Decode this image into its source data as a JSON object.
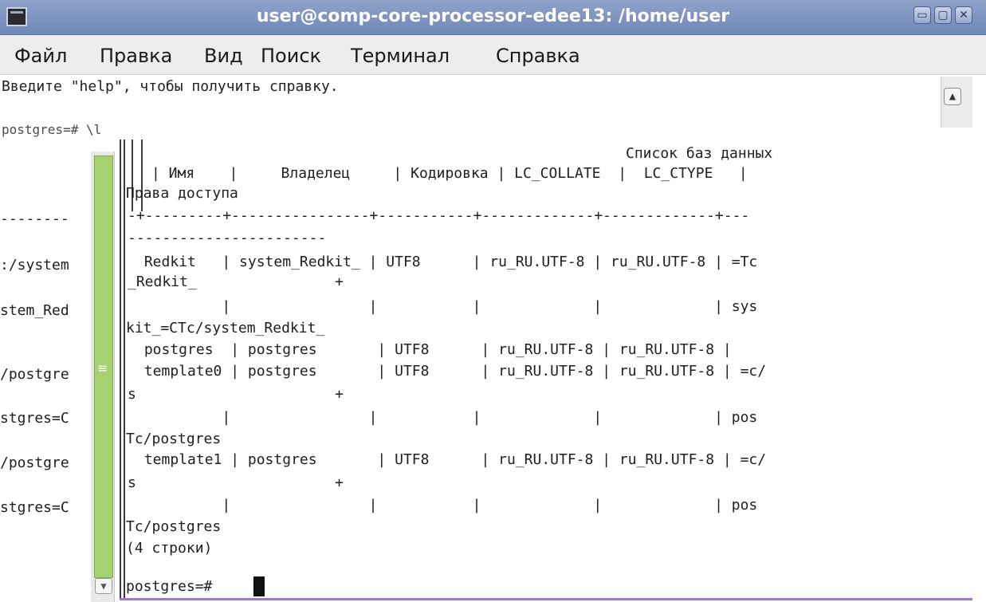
{
  "window": {
    "title": "user@comp-core-processor-edee13: /home/user",
    "app_icon": "terminal-icon",
    "buttons": {
      "minimize": "▭",
      "maximize": "▢",
      "close": "✕"
    }
  },
  "menu": [
    "Файл",
    "Правка",
    "Вид",
    "Поиск",
    "Терминал",
    "Справка"
  ],
  "terminal": {
    "help_line": "Введите \"help\", чтобы получить справку.",
    "cmd_echo": "postgres=# \\l",
    "table_title": "Список баз данных",
    "header": "| Имя    |     Владелец     | Кодировка | LC_COLLATE  |  LC_CTYPE   |",
    "header_wrap": "Права доступа",
    "sep1": "-+---------+----------------+-----------+-------------+-------------+---",
    "sep2": "-----------------------",
    "rows": [
      " Redkit   | system_Redkit_ | UTF8      | ru_RU.UTF-8 | ru_RU.UTF-8 | =Tc",
      "_Redkit_                +",
      "          |                |           |             |             | sys",
      "kit_=CTc/system_Redkit_",
      " postgres  | postgres       | UTF8      | ru_RU.UTF-8 | ru_RU.UTF-8 |",
      " template0 | postgres       | UTF8      | ru_RU.UTF-8 | ru_RU.UTF-8 | =c/",
      "s                       +",
      "          |                |           |             |             | pos",
      "Tc/postgres",
      " template1 | postgres       | UTF8      | ru_RU.UTF-8 | ru_RU.UTF-8 | =c/",
      "s                       +",
      "          |                |           |             |             | pos",
      "Tc/postgres"
    ],
    "row_count": "(4 строки)",
    "prompt": "postgres=# ",
    "left_fragments": [
      ":/system",
      "stem_Red",
      "/postgre",
      "stgres=C",
      "/postgre",
      "stgres=C"
    ],
    "left_dashes": "--------"
  }
}
